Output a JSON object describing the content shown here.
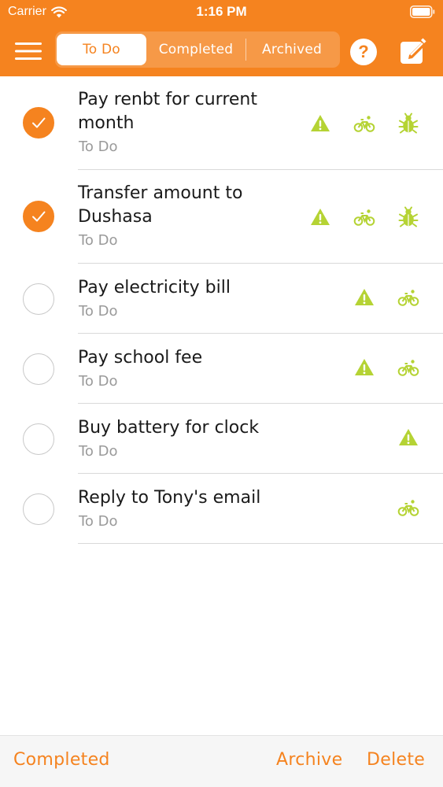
{
  "status_bar": {
    "carrier": "Carrier",
    "time": "1:16 PM"
  },
  "nav": {
    "segments": {
      "todo": "To Do",
      "completed": "Completed",
      "archived": "Archived"
    },
    "selected_segment": "To Do",
    "help_label": "?"
  },
  "tasks": [
    {
      "title": "Pay renbt for current month",
      "status": "To Do",
      "checked": true,
      "tags": [
        "warning-icon",
        "bicycle-icon",
        "bug-icon"
      ]
    },
    {
      "title": "Transfer amount to Dushasa",
      "status": "To Do",
      "checked": true,
      "tags": [
        "warning-icon",
        "bicycle-icon",
        "bug-icon"
      ]
    },
    {
      "title": "Pay electricity bill",
      "status": "To Do",
      "checked": false,
      "tags": [
        "warning-icon",
        "bicycle-icon"
      ]
    },
    {
      "title": "Pay school fee",
      "status": "To Do",
      "checked": false,
      "tags": [
        "warning-icon",
        "bicycle-icon"
      ]
    },
    {
      "title": "Buy battery for clock",
      "status": "To Do",
      "checked": false,
      "tags": [
        "warning-icon"
      ]
    },
    {
      "title": "Reply to Tony's email",
      "status": "To Do",
      "checked": false,
      "tags": [
        "bicycle-icon"
      ]
    }
  ],
  "toolbar": {
    "completed_label": "Completed",
    "archive_label": "Archive",
    "delete_label": "Delete"
  },
  "colors": {
    "accent": "#f5831f",
    "tag": "#b5d334",
    "divider": "#d9d9d9",
    "secondary_text": "#9a9a9a"
  }
}
